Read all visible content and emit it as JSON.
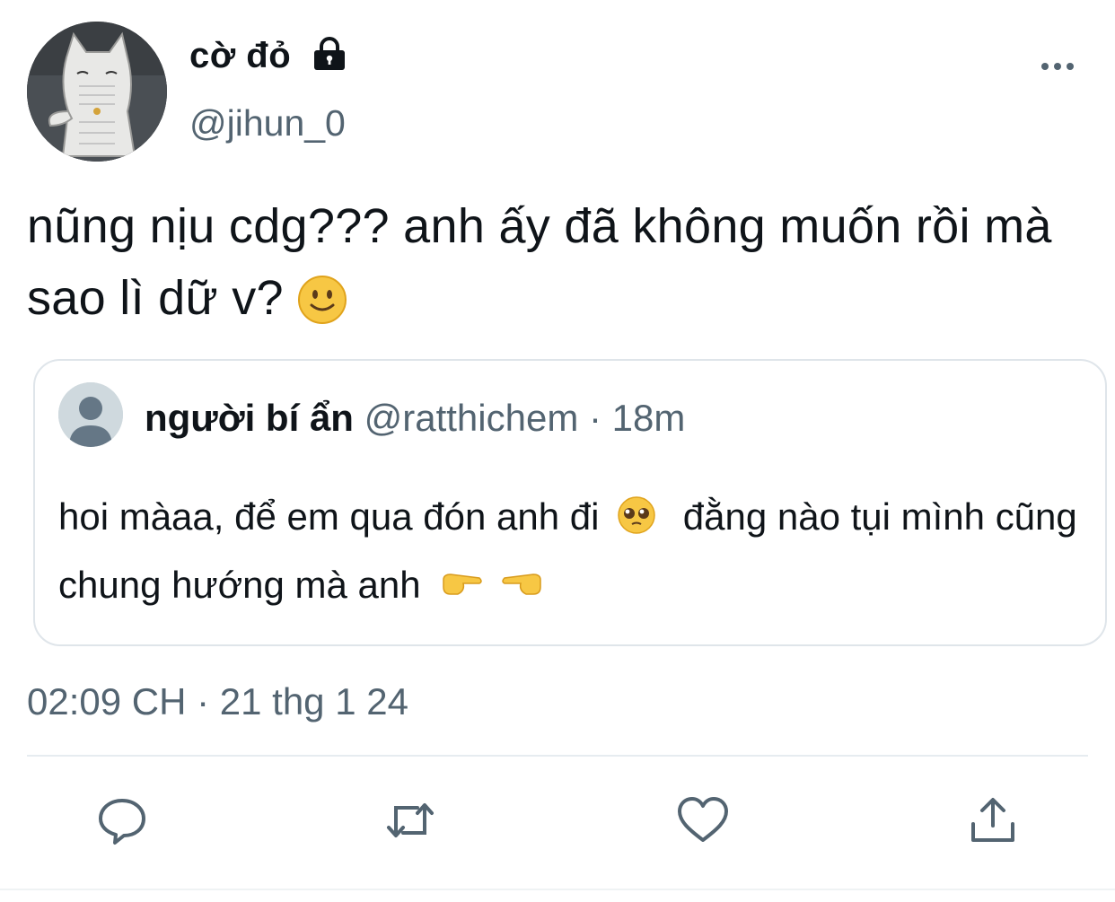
{
  "author": {
    "display_name": "cờ đỏ",
    "handle": "@jihun_0",
    "protected_icon": "lock-icon",
    "avatar": "cat-avatar"
  },
  "tweet": {
    "text": "nũng nịu cdg??? anh ấy đã không muốn rồi mà sao lì dữ v?",
    "trailing_emoji": "slightly-smiling-face-emoji",
    "timestamp": "02:09 CH · 21 thg 1 24"
  },
  "quoted_tweet": {
    "display_name": "người bí ẩn",
    "handle": "@ratthichem",
    "separator": "·",
    "age": "18m",
    "text_part1": "hoi màaa, để em qua đón anh đi",
    "text_part2": "đằng nào tụi mình cũng chung hướng mà anh",
    "emojis": [
      "pleading-face-emoji",
      "pointing-right-emoji",
      "pointing-left-emoji"
    ]
  },
  "actions": [
    "reply-icon",
    "retweet-icon",
    "like-icon",
    "share-icon"
  ],
  "colors": {
    "text_primary": "#0f1419",
    "text_secondary": "#536471",
    "border": "#dfe5ea",
    "icon": "#536471",
    "emoji_yellow": "#f7c744"
  }
}
